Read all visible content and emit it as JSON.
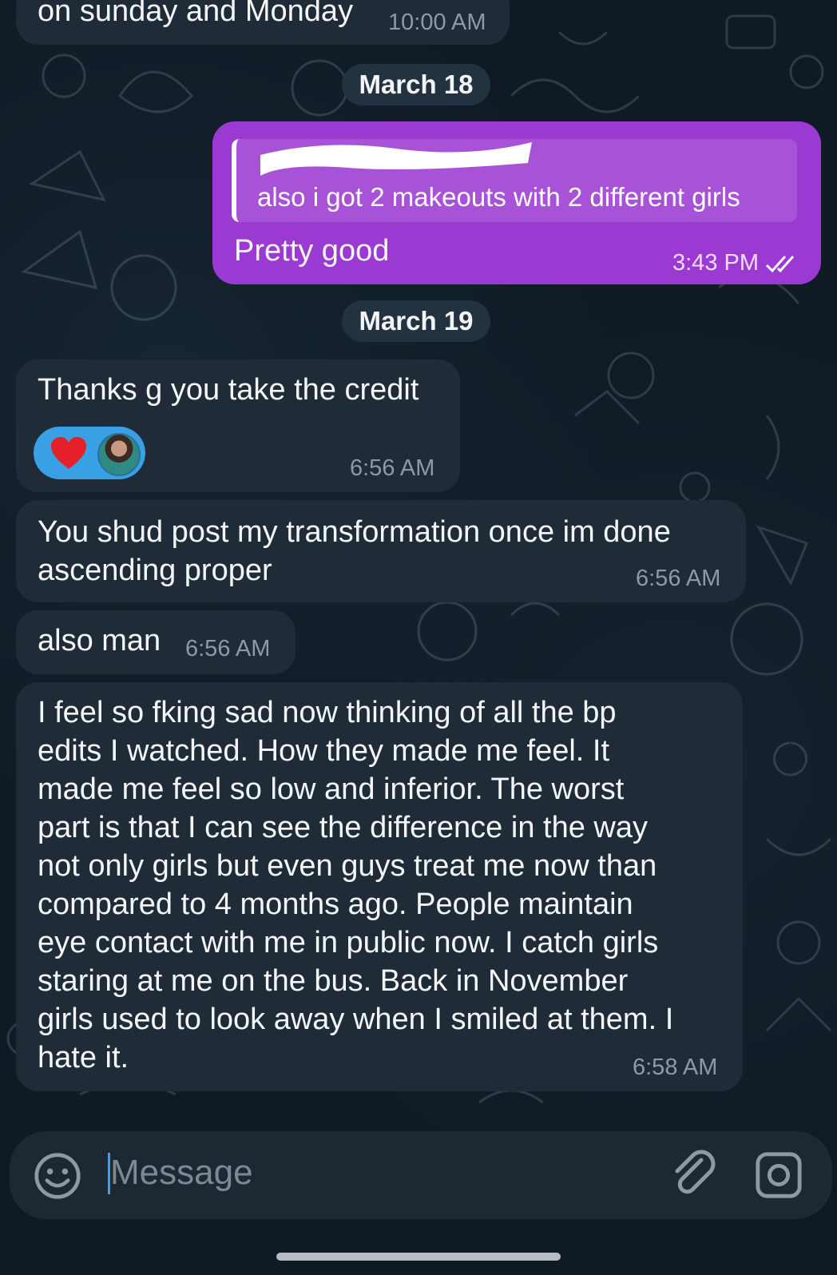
{
  "messages": [
    {
      "text": "on sunday and Monday",
      "time": "10:00 AM"
    },
    {
      "reply_text": "also i got 2 makeouts with 2 different girls",
      "text": "Pretty good",
      "time": "3:43 PM"
    },
    {
      "text": "Thanks g you take the credit",
      "time": "6:56 AM",
      "reaction": "heart"
    },
    {
      "text_lines": [
        "You shud post my transformation once im done",
        "ascending proper"
      ],
      "time": "6:56 AM"
    },
    {
      "text": "also man",
      "time": "6:56 AM"
    },
    {
      "text_lines": [
        "I feel so fking sad now thinking of all the bp",
        "edits I watched. How they made me feel. It",
        "made me feel so low and inferior. The worst",
        "part is that I can see the difference in the way",
        "not only girls but even guys treat me now than",
        "compared to 4 months ago. People maintain",
        "eye contact with me in public now. I catch girls",
        "staring at me on the bus. Back in November",
        "girls used to look away when I smiled at them. I",
        "hate it."
      ],
      "time": "6:58 AM"
    }
  ],
  "dates": [
    "March 18",
    "March 19"
  ],
  "composer": {
    "placeholder": "Message"
  },
  "colors": {
    "outgoing_bubble": "#9b3ad2",
    "incoming_bubble": "#1f2c38",
    "reaction_pill": "#3aa0e4",
    "background": "#0f1a24"
  },
  "icons": [
    "smiley-icon",
    "attach-icon",
    "camera-icon",
    "double-check-icon",
    "heart-icon"
  ]
}
